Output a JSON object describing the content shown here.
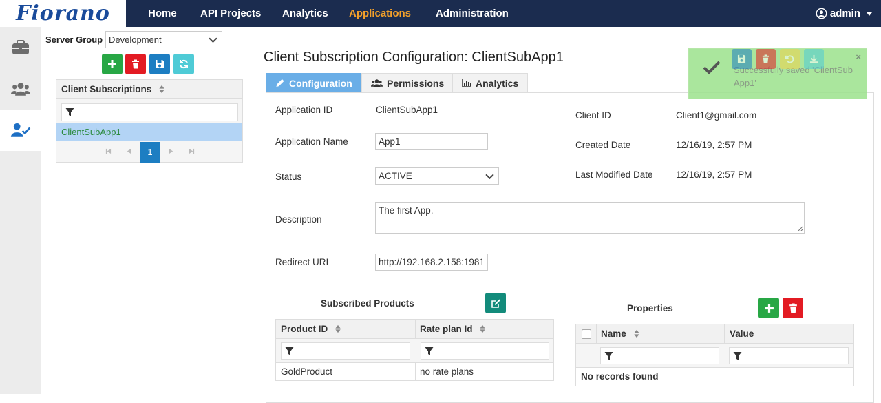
{
  "nav": {
    "logo": "Fiorano",
    "items": [
      "Home",
      "API Projects",
      "Analytics",
      "Applications",
      "Administration"
    ],
    "active": "Applications",
    "user": "admin"
  },
  "rail": {
    "items": [
      "briefcase-icon",
      "users-icon",
      "user-check-icon"
    ],
    "active_index": 2
  },
  "server_group": {
    "label": "Server Group",
    "value": "Development"
  },
  "client_subscriptions": {
    "header": "Client Subscriptions",
    "rows": [
      "ClientSubApp1"
    ],
    "current_page": "1"
  },
  "main": {
    "title": "Client Subscription Configuration: ClientSubApp1",
    "tabs": [
      "Configuration",
      "Permissions",
      "Analytics"
    ],
    "active_tab": "Configuration"
  },
  "form": {
    "application_id_label": "Application ID",
    "application_id": "ClientSubApp1",
    "application_name_label": "Application Name",
    "application_name": "App1",
    "status_label": "Status",
    "status": "ACTIVE",
    "description_label": "Description",
    "description": "The first App.",
    "redirect_uri_label": "Redirect URI",
    "redirect_uri": "http://192.168.2.158:1981",
    "client_id_label": "Client ID",
    "client_id": "Client1@gmail.com",
    "created_date_label": "Created Date",
    "created_date": "12/16/19, 2:57 PM",
    "last_modified_label": "Last Modified Date",
    "last_modified": "12/16/19, 2:57 PM"
  },
  "subscribed_products": {
    "title": "Subscribed Products",
    "columns": [
      "Product ID",
      "Rate plan Id"
    ],
    "rows": [
      [
        "GoldProduct",
        "no rate plans"
      ]
    ]
  },
  "properties": {
    "title": "Properties",
    "columns": [
      "Name",
      "Value"
    ],
    "empty_message": "No records found"
  },
  "toast": {
    "message": "Successfully saved 'ClientSub App1'",
    "close": "×"
  },
  "colors": {
    "nav_bg": "#1b2c4f",
    "nav_active": "#f4a12a",
    "primary": "#1d7ec2",
    "success": "#28a745",
    "danger": "#e31b23",
    "toast_bg": "#9be28c"
  }
}
